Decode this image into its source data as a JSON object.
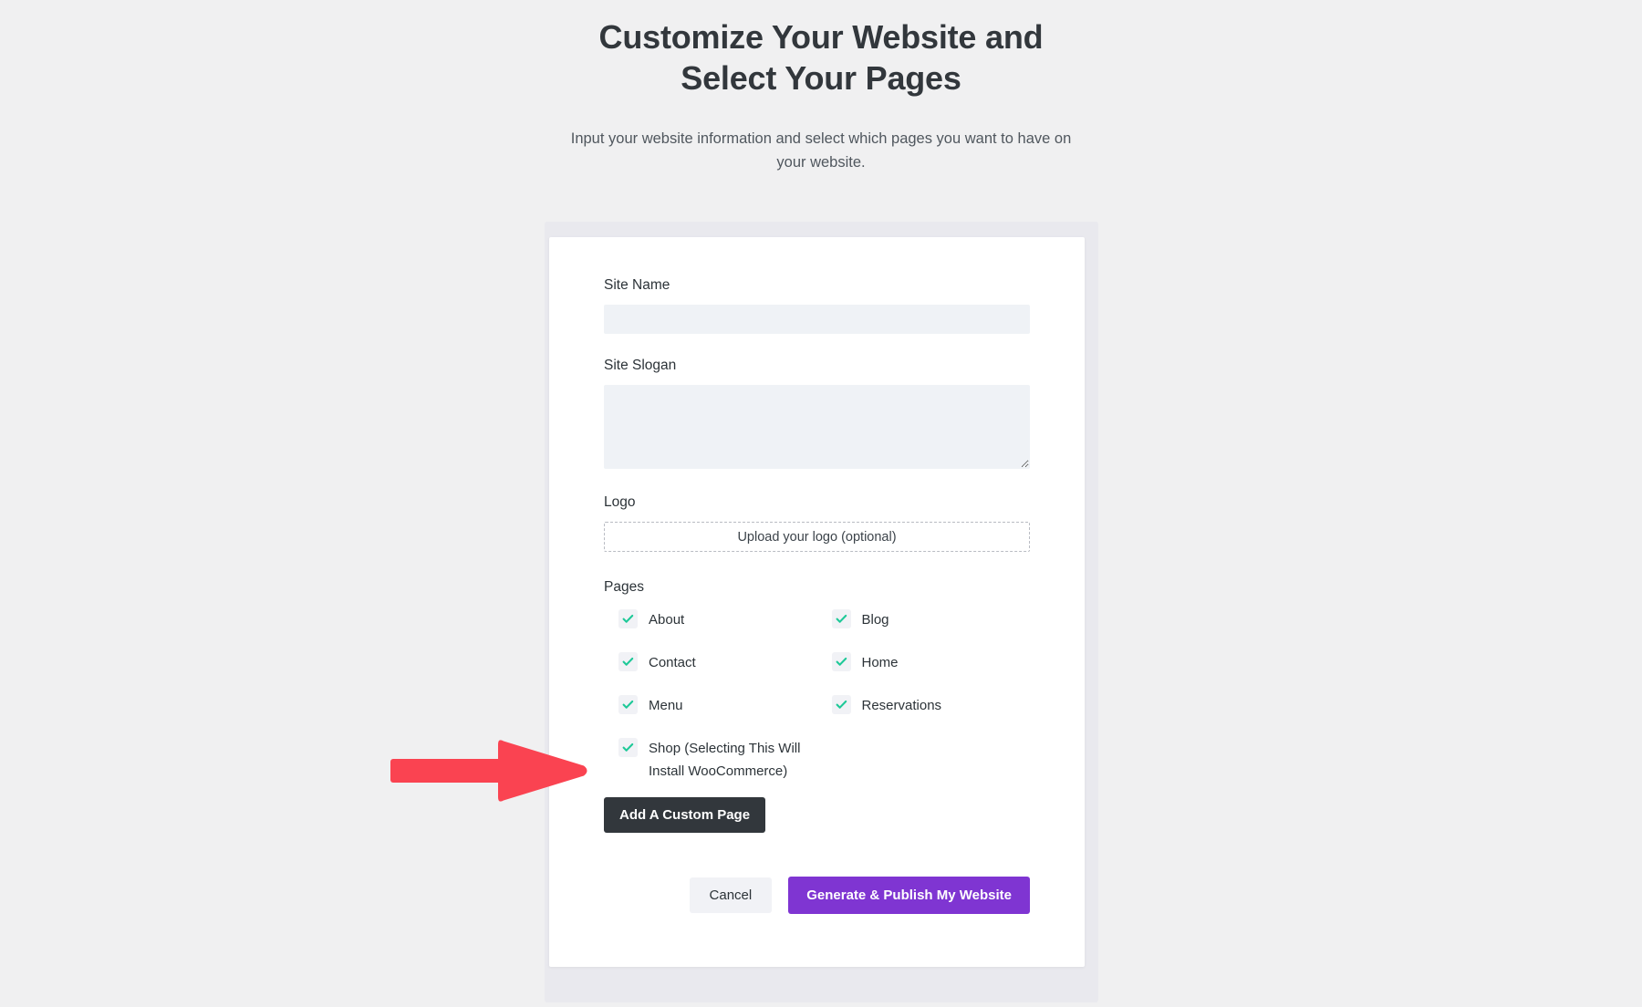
{
  "header": {
    "title": "Customize Your Website and Select Your Pages",
    "subtitle": "Input your website information and select which pages you want to have on your website."
  },
  "form": {
    "site_name": {
      "label": "Site Name",
      "value": "",
      "placeholder": ""
    },
    "site_slogan": {
      "label": "Site Slogan",
      "value": "",
      "placeholder": ""
    },
    "logo": {
      "label": "Logo",
      "upload_label": "Upload your logo (optional)"
    },
    "pages": {
      "label": "Pages",
      "options": [
        {
          "label": "About",
          "checked": true
        },
        {
          "label": "Blog",
          "checked": true
        },
        {
          "label": "Contact",
          "checked": true
        },
        {
          "label": "Home",
          "checked": true
        },
        {
          "label": "Menu",
          "checked": true
        },
        {
          "label": "Reservations",
          "checked": true
        },
        {
          "label": "Shop (Selecting This Will Install WooCommerce)",
          "checked": true
        }
      ]
    },
    "add_custom_page_label": "Add A Custom Page"
  },
  "actions": {
    "cancel_label": "Cancel",
    "publish_label": "Generate & Publish My Website"
  },
  "annotation": {
    "arrow_icon": "right-arrow-icon",
    "points_at": "Shop (Selecting This Will Install WooCommerce)"
  },
  "colors": {
    "page_background": "#f0f0f1",
    "card_background": "#ffffff",
    "backdrop": "#e9e9ee",
    "input_background": "#eff2f6",
    "checkbox_background": "#f1f2f6",
    "checkmark": "#1ec998",
    "dark_button": "#32373c",
    "primary_button": "#7f35d2",
    "cancel_button": "#f1f2f6",
    "arrow_red": "#fa4351",
    "heading_text": "#32373c",
    "body_text": "#50575e"
  }
}
